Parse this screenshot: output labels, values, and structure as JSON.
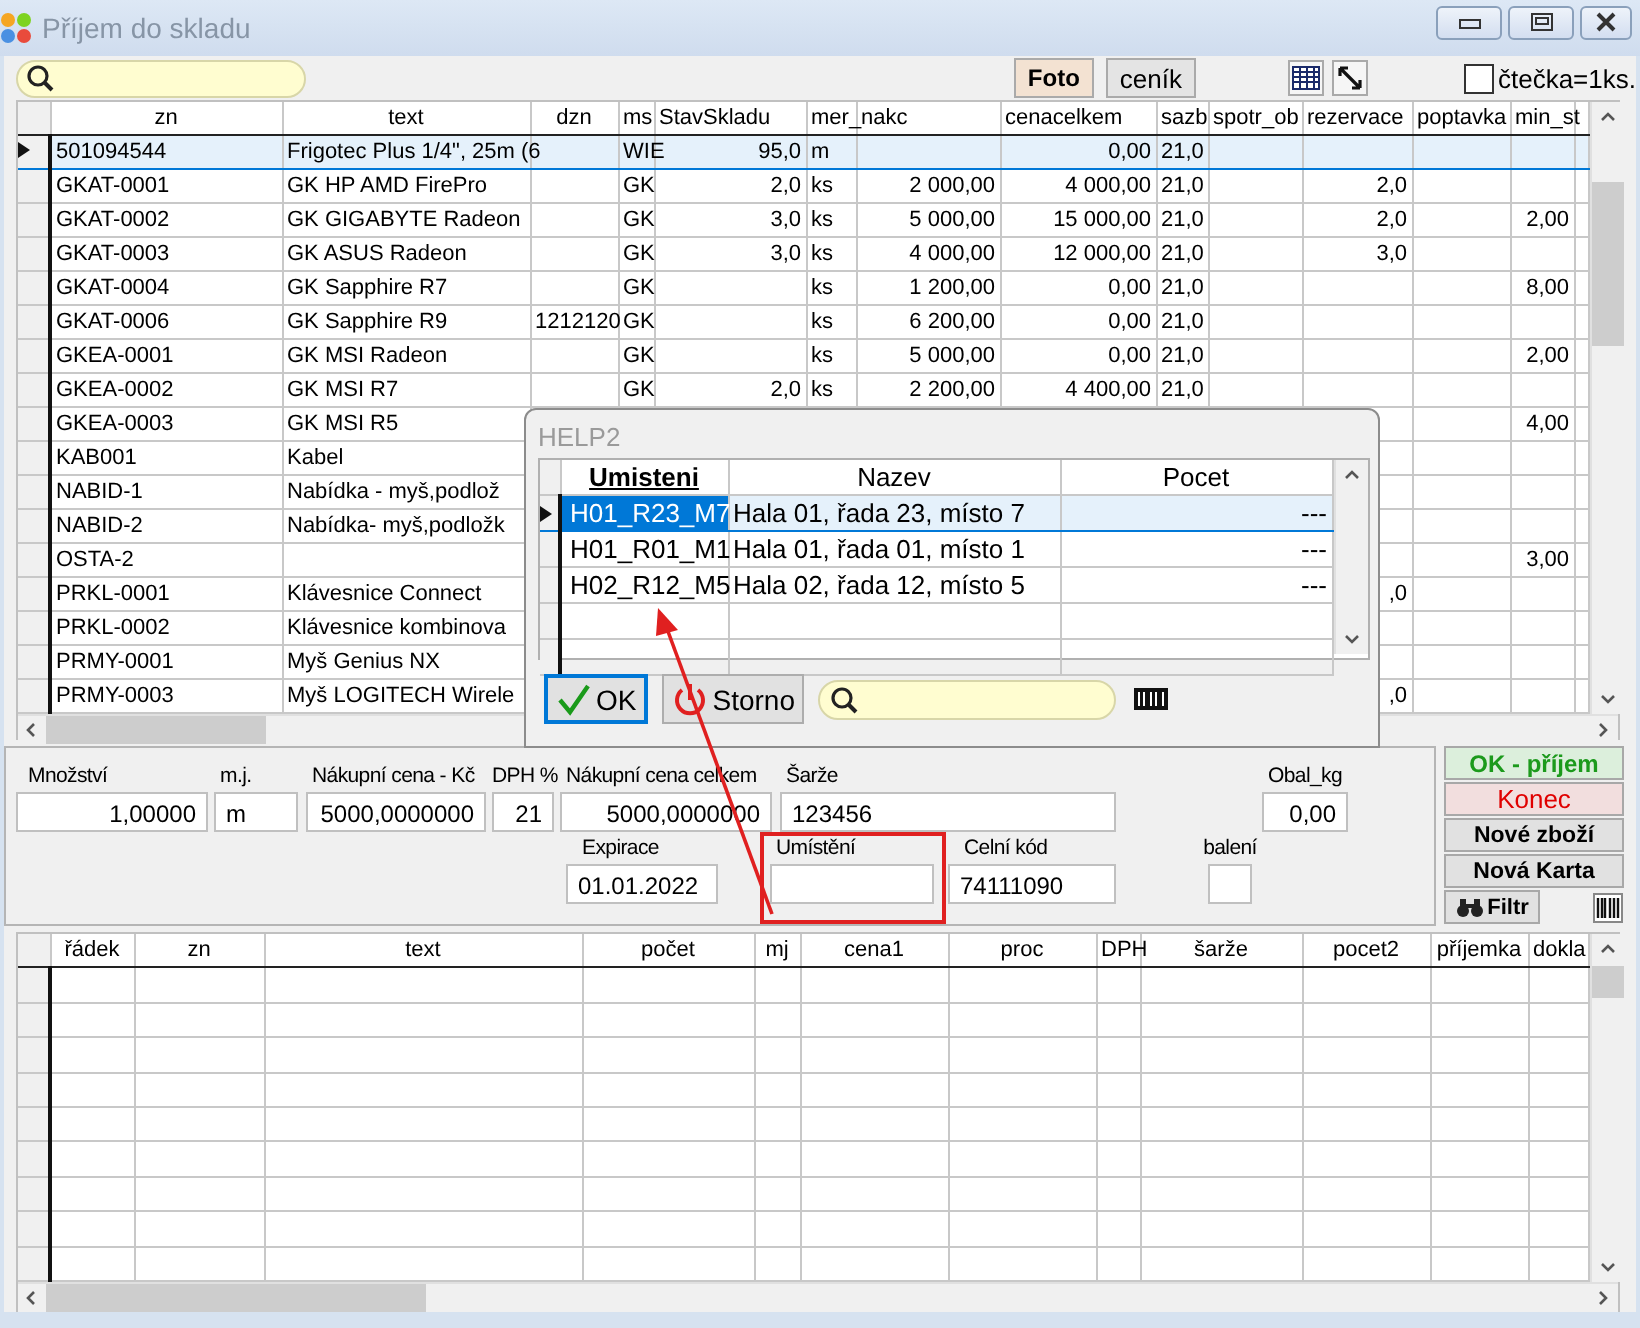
{
  "window": {
    "title": "Příjem do skladu"
  },
  "toolbar": {
    "buttons": [
      {
        "label": "Foto",
        "selected": true
      },
      {
        "label": "ceník",
        "selected": false
      }
    ],
    "checkbox": {
      "label": "čtečka=1ks.",
      "checked": false
    }
  },
  "items_grid": {
    "columns": [
      {
        "label": "zn",
        "kind": "text"
      },
      {
        "label": "text",
        "kind": "text"
      },
      {
        "label": "dzn",
        "kind": "text"
      },
      {
        "label": "ms",
        "kind": "code"
      },
      {
        "label": "StavSkladu",
        "kind": "number"
      },
      {
        "label": "mer_nakc",
        "kind": "code"
      },
      {
        "kind": "number"
      },
      {
        "label": "cenacelkem",
        "kind": "number"
      },
      {
        "label": "sazb",
        "kind": "code"
      },
      {
        "label": "spotr_ob",
        "kind": "number"
      },
      {
        "label": "rezervace",
        "kind": "number"
      },
      {
        "label": "poptavka",
        "kind": "number"
      },
      {
        "label": "min_st",
        "kind": "number"
      }
    ],
    "rows": [
      {
        "selected": true,
        "cells": [
          "501094544",
          "Frigotec Plus 1/4\", 25m (6",
          null,
          "WIE",
          "95,0",
          "m",
          null,
          "0,00",
          "21,0",
          null,
          null,
          null,
          null
        ]
      },
      {
        "selected": false,
        "cells": [
          "GKAT-0001",
          "GK HP AMD FirePro",
          null,
          "GK",
          "2,0",
          "ks",
          "2 000,00",
          "4 000,00",
          "21,0",
          null,
          "2,0",
          null,
          null
        ]
      },
      {
        "selected": false,
        "cells": [
          "GKAT-0002",
          "GK  GIGABYTE Radeon",
          null,
          "GK",
          "3,0",
          "ks",
          "5 000,00",
          "15 000,00",
          "21,0",
          null,
          "2,0",
          null,
          "2,00"
        ]
      },
      {
        "selected": false,
        "cells": [
          "GKAT-0003",
          "GK ASUS Radeon",
          null,
          "GK",
          "3,0",
          "ks",
          "4 000,00",
          "12 000,00",
          "21,0",
          null,
          "3,0",
          null,
          null
        ]
      },
      {
        "selected": false,
        "cells": [
          "GKAT-0004",
          "GK Sapphire R7",
          null,
          "GK",
          null,
          "ks",
          "1 200,00",
          "0,00",
          "21,0",
          null,
          null,
          null,
          "8,00"
        ]
      },
      {
        "selected": false,
        "cells": [
          "GKAT-0006",
          "GK Sapphire R9",
          "1212120",
          "GK",
          null,
          "ks",
          "6 200,00",
          "0,00",
          "21,0",
          null,
          null,
          null,
          null
        ]
      },
      {
        "selected": false,
        "cells": [
          "GKEA-0001",
          "GK MSI  Radeon",
          null,
          "GK",
          null,
          "ks",
          "5 000,00",
          "0,00",
          "21,0",
          null,
          null,
          null,
          "2,00"
        ]
      },
      {
        "selected": false,
        "cells": [
          "GKEA-0002",
          "GK MSI R7",
          null,
          "GK",
          "2,0",
          "ks",
          "2 200,00",
          "4 400,00",
          "21,0",
          null,
          null,
          null,
          null
        ]
      },
      {
        "selected": false,
        "cells": [
          "GKEA-0003",
          "GK MSI R5",
          null,
          null,
          null,
          null,
          null,
          null,
          null,
          null,
          null,
          null,
          "4,00"
        ]
      },
      {
        "selected": false,
        "cells": [
          "KAB001",
          "Kabel",
          null,
          null,
          null,
          null,
          null,
          null,
          null,
          null,
          null,
          null,
          null
        ]
      },
      {
        "selected": false,
        "cells": [
          "NABID-1",
          "Nabídka - myš,podlož",
          null,
          null,
          null,
          null,
          null,
          null,
          null,
          null,
          null,
          null,
          null
        ]
      },
      {
        "selected": false,
        "cells": [
          "NABID-2",
          "Nabídka- myš,podložk",
          null,
          null,
          null,
          null,
          null,
          null,
          null,
          null,
          null,
          null,
          null
        ]
      },
      {
        "selected": false,
        "cells": [
          "OSTA-2",
          null,
          null,
          null,
          null,
          null,
          null,
          null,
          null,
          null,
          null,
          null,
          "3,00"
        ]
      },
      {
        "selected": false,
        "cells": [
          "PRKL-0001",
          "Klávesnice Connect",
          null,
          null,
          null,
          null,
          null,
          null,
          null,
          null,
          ",0",
          null,
          null
        ]
      },
      {
        "selected": false,
        "cells": [
          "PRKL-0002",
          "Klávesnice kombinova",
          null,
          null,
          null,
          null,
          null,
          null,
          null,
          null,
          null,
          null,
          null
        ]
      },
      {
        "selected": false,
        "cells": [
          "PRMY-0001",
          "Myš Genius NX",
          null,
          null,
          null,
          null,
          null,
          null,
          null,
          null,
          null,
          null,
          null
        ]
      },
      {
        "selected": false,
        "cells": [
          "PRMY-0003",
          "Myš LOGITECH Wirele",
          null,
          null,
          null,
          null,
          null,
          null,
          null,
          null,
          ",0",
          null,
          null
        ]
      }
    ]
  },
  "form": {
    "row_1": [
      {
        "label": "Množství",
        "value": "1,00000",
        "kind": "number"
      },
      {
        "label": "m.j.",
        "value": "m",
        "kind": "text"
      },
      {
        "label": "Nákupní cena - Kč",
        "value": "5000,0000000",
        "kind": "number"
      },
      {
        "label": "DPH %",
        "value": "21",
        "kind": "number"
      },
      {
        "label": "Nákupní cena celkem",
        "value": "5000,0000000",
        "kind": "number"
      },
      {
        "label": "Šarže",
        "value": "123456",
        "kind": "text"
      },
      {
        "label": "Obal_kg",
        "value": "0,00",
        "kind": "number"
      }
    ],
    "row_2": [
      {
        "label": "Expirace",
        "value": "01.01.2022",
        "kind": "text"
      },
      {
        "label": "Umístění"
      },
      {
        "label": "Celní kód",
        "value": "74111090",
        "kind": "text"
      },
      {
        "label": "balení"
      }
    ]
  },
  "actions": [
    {
      "label": "OK - příjem",
      "kind": "confirm"
    },
    {
      "label": "Konec",
      "kind": "exit"
    },
    {
      "label": "Nové zboží",
      "kind": "plain"
    },
    {
      "label": "Nová Karta",
      "kind": "plain"
    },
    {
      "label": "Filtr",
      "kind": "filter"
    }
  ],
  "lines_grid": {
    "columns": [
      "řádek",
      "zn",
      "text",
      "počet",
      "mj",
      "cena1",
      "proc",
      "DPH",
      "šarže",
      "pocet2",
      "příjemka",
      "dokla"
    ]
  },
  "dialog": {
    "title": "HELP2",
    "columns": [
      {
        "label": "Umisteni",
        "sorted": true
      },
      {
        "label": "Nazev",
        "sorted": false
      },
      {
        "label": "Pocet",
        "sorted": false
      }
    ],
    "rows": [
      {
        "selected": true,
        "cells": [
          "H01_R23_M7",
          "Hala 01, řada 23, místo 7",
          "---"
        ]
      },
      {
        "selected": false,
        "cells": [
          "H01_R01_M1",
          "Hala 01, řada 01, místo 1",
          "---"
        ]
      },
      {
        "selected": false,
        "cells": [
          "H02_R12_M5",
          "Hala 02, řada 12, místo 5",
          "---"
        ]
      }
    ],
    "buttons": [
      {
        "label": "OK",
        "kind": "ok",
        "focused": true
      },
      {
        "label": "Storno",
        "kind": "cancel",
        "focused": false
      }
    ]
  }
}
